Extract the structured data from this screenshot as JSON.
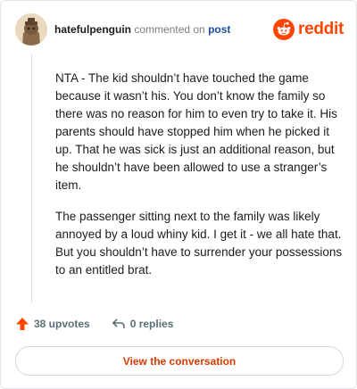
{
  "comment": {
    "username": "hatefulpenguin",
    "verb": "commented on",
    "post_link": "post",
    "paragraphs": [
      "NTA - The kid shouldn’t have touched the game because it wasn’t his. You don’t know the family so there was no reason for him to even try to take it. His parents should have stopped him when he picked it up. That he was sick is just an additional reason, but he shouldn’t have been allowed to use a stranger’s item.",
      "The passenger sitting next to the family was likely annoyed by a loud whiny kid. I get it - we all hate that. But you shouldn’t have to surrender your possessions to an entitled brat."
    ]
  },
  "brand": {
    "wordmark": "reddit",
    "icon": "reddit-snoo-icon",
    "color": "#ff4500"
  },
  "actions": {
    "upvotes": "38 upvotes",
    "upvote_icon": "upvote-arrow-icon",
    "upvote_color": "#ff4500",
    "replies": "0 replies",
    "reply_icon": "reply-arrow-icon"
  },
  "cta": {
    "label": "View the conversation",
    "color": "#d93a00"
  }
}
